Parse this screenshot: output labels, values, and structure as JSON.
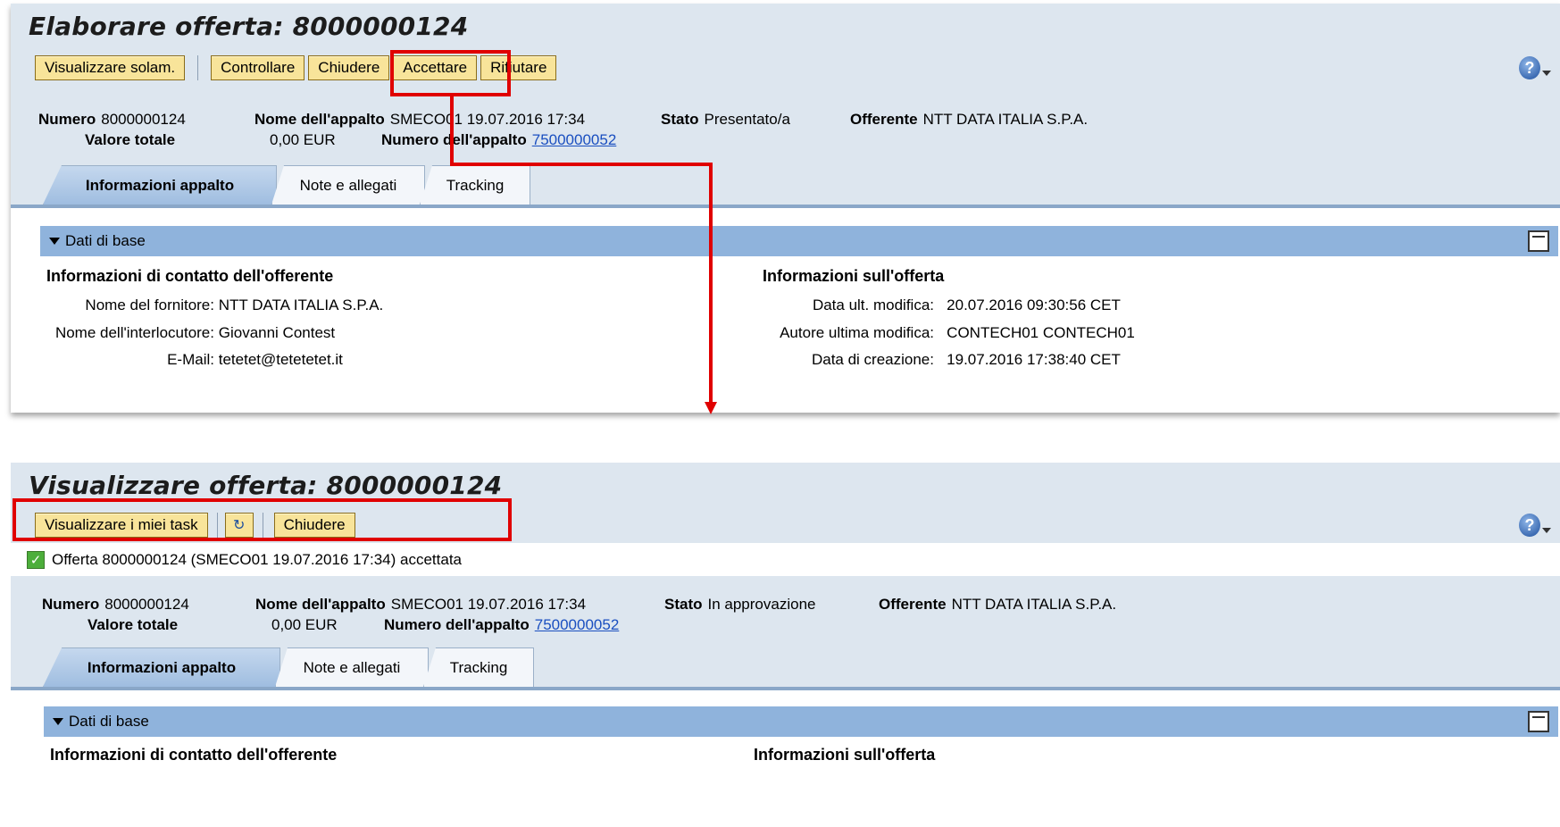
{
  "top": {
    "title": "Elaborare offerta: 8000000124",
    "toolbar": {
      "view_only": "Visualizzare solam.",
      "check": "Controllare",
      "close": "Chiudere",
      "accept": "Accettare",
      "reject": "Rifiutare"
    },
    "header": {
      "numero_label": "Numero",
      "numero_value": "8000000124",
      "valore_label": "Valore totale",
      "valore_value": "0,00 EUR",
      "nome_appalto_label": "Nome dell'appalto",
      "nome_appalto_value": "SMECO01 19.07.2016 17:34",
      "numero_appalto_label": "Numero dell'appalto",
      "numero_appalto_value": "7500000052",
      "stato_label": "Stato",
      "stato_value": "Presentato/a",
      "offerente_label": "Offerente",
      "offerente_value": "NTT DATA ITALIA S.P.A."
    },
    "tabs": [
      "Informazioni appalto",
      "Note e allegati",
      "Tracking"
    ],
    "section_title": "Dati di base",
    "contact": {
      "title": "Informazioni di contatto dell'offerente",
      "supplier_label": "Nome del fornitore:",
      "supplier_value": "NTT DATA ITALIA S.P.A.",
      "contact_label": "Nome dell'interlocutore:",
      "contact_value": "Giovanni Contest",
      "email_label": "E-Mail:",
      "email_value": "tetetet@tetetetet.it"
    },
    "offer": {
      "title": "Informazioni sull'offerta",
      "modified_label": "Data ult. modifica:",
      "modified_value": "20.07.2016 09:30:56 CET",
      "author_label": "Autore ultima modifica:",
      "author_value": "CONTECH01 CONTECH01",
      "created_label": "Data di creazione:",
      "created_value": "19.07.2016 17:38:40 CET"
    }
  },
  "bottom": {
    "title": "Visualizzare offerta: 8000000124",
    "toolbar": {
      "my_tasks": "Visualizzare i miei task",
      "refresh_icon": "refresh-icon",
      "close": "Chiudere"
    },
    "message": "Offerta 8000000124 (SMECO01 19.07.2016 17:34) accettata",
    "header": {
      "numero_label": "Numero",
      "numero_value": "8000000124",
      "valore_label": "Valore totale",
      "valore_value": "0,00 EUR",
      "nome_appalto_label": "Nome dell'appalto",
      "nome_appalto_value": "SMECO01 19.07.2016 17:34",
      "numero_appalto_label": "Numero dell'appalto",
      "numero_appalto_value": "7500000052",
      "stato_label": "Stato",
      "stato_value": "In approvazione",
      "offerente_label": "Offerente",
      "offerente_value": "NTT DATA ITALIA S.P.A."
    },
    "tabs": [
      "Informazioni appalto",
      "Note e allegati",
      "Tracking"
    ],
    "section_title": "Dati di base",
    "contact_title": "Informazioni di contatto dell'offerente",
    "offer_title": "Informazioni sull'offerta"
  },
  "colors": {
    "highlight": "#e00000",
    "header_bg": "#dde6ef",
    "button_bg": "#f8e49a",
    "section_bar": "#8fb3dc"
  }
}
